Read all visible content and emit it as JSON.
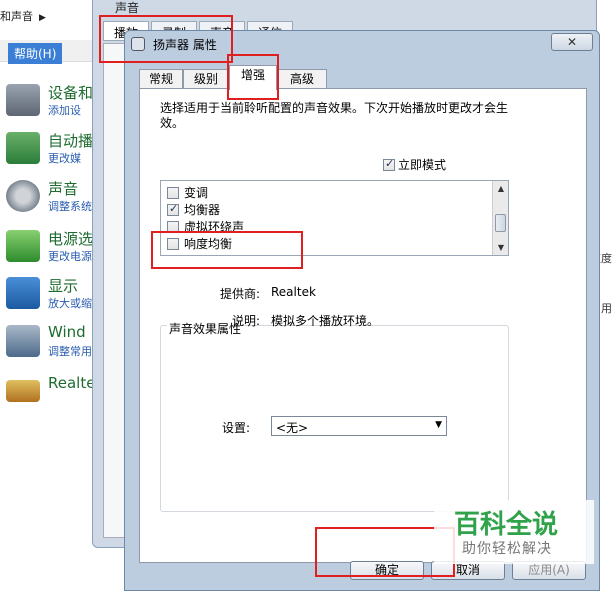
{
  "background": {
    "breadcrumb": "和声音",
    "menu_help": "帮助(H)",
    "items": [
      {
        "title": "设备和",
        "sub": "添加设",
        "icon": "printer-icon"
      },
      {
        "title": "自动播",
        "sub": "更改媒",
        "icon": "autoplay-icon"
      },
      {
        "title": "声音",
        "sub": "调整系统",
        "icon": "speaker-icon"
      },
      {
        "title": "电源选",
        "sub": "更改电源",
        "icon": "battery-icon"
      },
      {
        "title": "显示",
        "sub": "放大或缩",
        "icon": "monitor-icon"
      },
      {
        "title": "Wind",
        "sub": "调整常用",
        "icon": "windows-mobility-icon"
      },
      {
        "title": "Realte",
        "sub": "",
        "icon": "realtek-audio-icon"
      }
    ],
    "right_fragments": [
      "速度",
      "用"
    ]
  },
  "sound_dialog": {
    "title": "声音",
    "tabs": [
      "播放",
      "录制",
      "声音",
      "通信"
    ]
  },
  "properties_dialog": {
    "title": "扬声器 属性",
    "close_label": "✕",
    "tabs": [
      "常规",
      "级别",
      "增强",
      "高级"
    ],
    "active_tab": "增强",
    "description": "选择适用于当前聆听配置的声音效果。下次开始播放时更改才会生效。",
    "instant_mode_label": "立即模式",
    "instant_mode_checked": true,
    "effects": [
      {
        "label": "变调",
        "checked": false
      },
      {
        "label": "均衡器",
        "checked": true
      },
      {
        "label": "虚拟环绕声",
        "checked": false
      },
      {
        "label": "响度均衡",
        "checked": false
      }
    ],
    "effect_props_title": "声音效果属性",
    "provider_label": "提供商:",
    "provider_value": "Realtek",
    "description_label": "说明:",
    "description_value": "模拟多个播放环境。",
    "settings_label": "设置:",
    "settings_value": "<无>",
    "buttons": {
      "ok": "确定",
      "cancel": "取消",
      "apply": "应用(A)"
    }
  },
  "watermark": {
    "main": "百科全说",
    "sub": "助你轻松解决"
  },
  "colors": {
    "highlight": "#e02020",
    "link_green": "#1e6b2f",
    "link_blue": "#2a5db0"
  }
}
